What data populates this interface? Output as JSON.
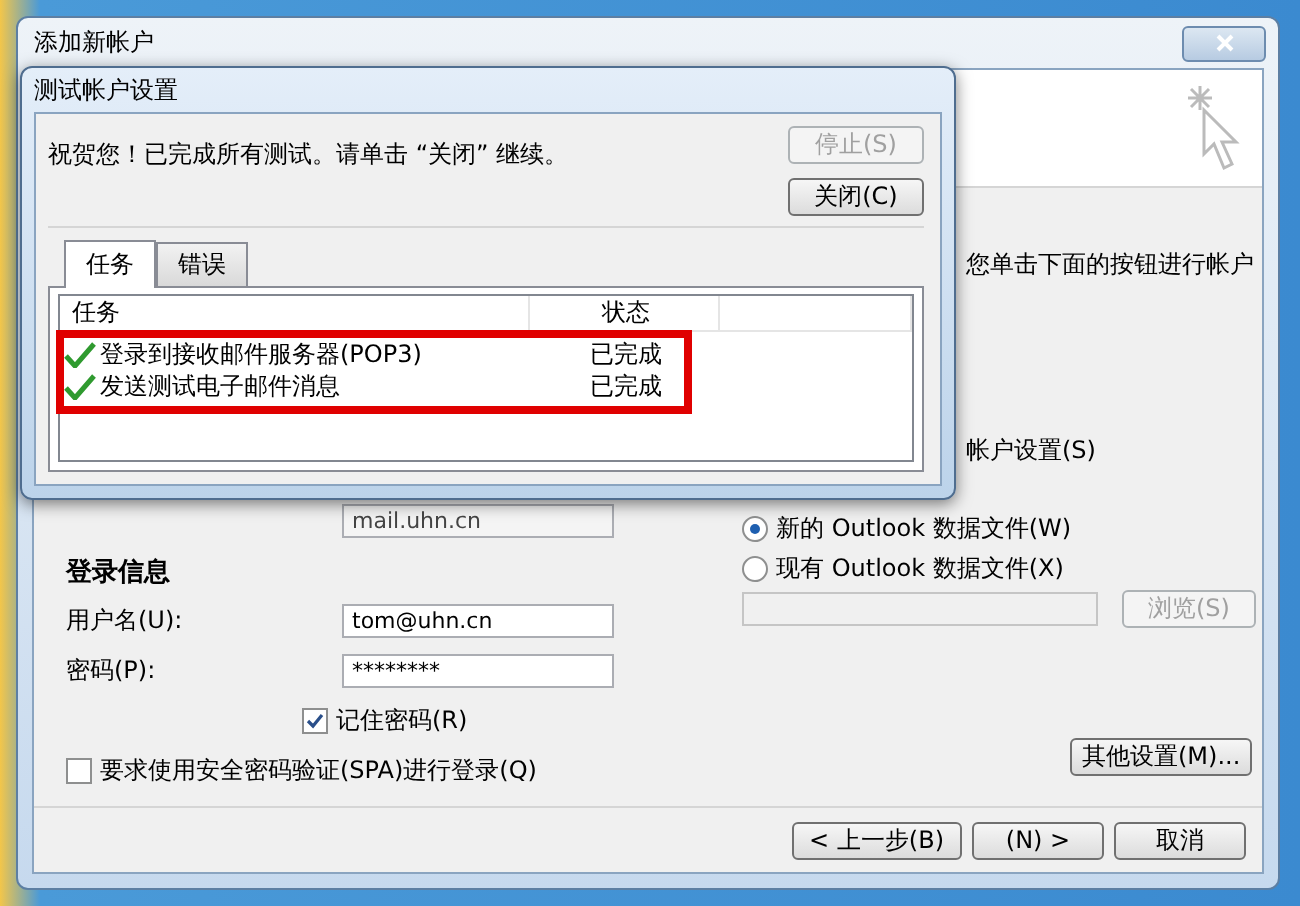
{
  "window": {
    "title": "添加新帐户"
  },
  "background": {
    "description_partial": "您单击下面的按钮进行帐户",
    "test_button_partial": "帐户设置(S)",
    "outgoing_server_value": "mail.uhn.cn"
  },
  "login": {
    "heading": "登录信息",
    "username": {
      "label": "用户名(U):",
      "value": "tom@uhn.cn"
    },
    "password": {
      "label": "密码(P):",
      "value": "********"
    },
    "remember": {
      "label": "记住密码(R)",
      "checked": true
    },
    "spa": {
      "label": "要求使用安全密码验证(SPA)进行登录(Q)",
      "checked": false
    }
  },
  "data_file": {
    "options": [
      {
        "label": "新的 Outlook 数据文件(W)",
        "selected": true
      },
      {
        "label": "现有 Outlook 数据文件(X)",
        "selected": false
      }
    ],
    "path": {
      "disabled": true
    },
    "browse": {
      "label": "浏览(S)",
      "disabled": true
    }
  },
  "more_settings": "其他设置(M)...",
  "nav_buttons": [
    {
      "label": "< 上一步(B)"
    },
    {
      "label": "(N) >"
    },
    {
      "label": "取消"
    }
  ],
  "test_dialog": {
    "title": "测试帐户设置",
    "message": "祝贺您！已完成所有测试。请单击 “关闭” 继续。",
    "buttons": [
      {
        "label": "停止(S)",
        "disabled": true
      },
      {
        "label": "关闭(C)",
        "disabled": false
      }
    ],
    "tabs": [
      {
        "label": "任务",
        "selected": true
      },
      {
        "label": "错误",
        "selected": false
      }
    ],
    "columns": [
      "任务",
      "状态"
    ],
    "tasks": [
      {
        "name": "登录到接收邮件服务器(POP3)",
        "status": "已完成",
        "done": true
      },
      {
        "name": "发送测试电子邮件消息",
        "status": "已完成",
        "done": true
      }
    ],
    "highlight": true
  }
}
